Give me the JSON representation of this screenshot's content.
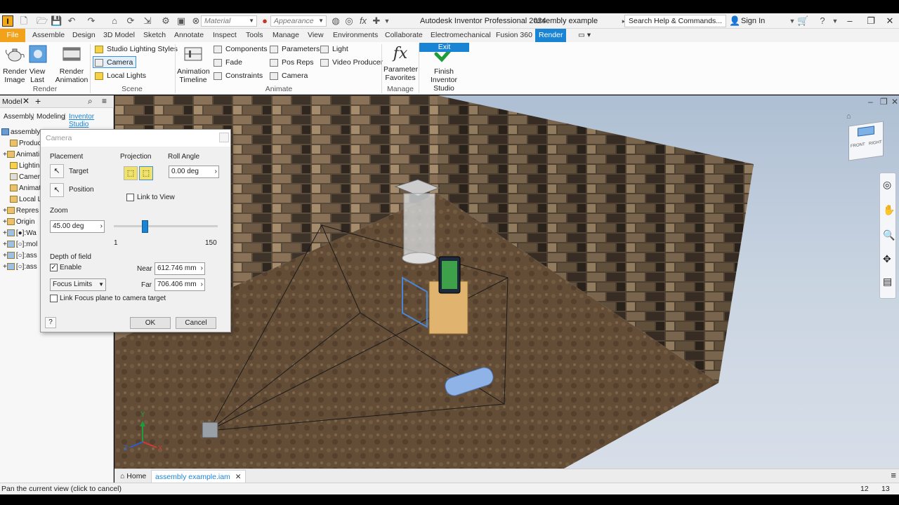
{
  "window": {
    "app_title": "Autodesk Inventor Professional 2024",
    "doc_title": "assembly example",
    "search_placeholder": "Search Help & Commands...",
    "sign_in": "Sign In",
    "material_combo": "Material",
    "appearance_combo": "Appearance"
  },
  "menu_tabs": [
    "File",
    "Assemble",
    "Design",
    "3D Model",
    "Sketch",
    "Annotate",
    "Inspect",
    "Tools",
    "Manage",
    "View",
    "Environments",
    "Collaborate",
    "Electromechanical",
    "Fusion 360",
    "Render"
  ],
  "ribbon": {
    "render_image": [
      "Render",
      "Image"
    ],
    "view_last": [
      "View",
      "Last"
    ],
    "render_animation": [
      "Render",
      "Animation"
    ],
    "render_group": "Render",
    "studio_lighting": "Studio Lighting Styles",
    "camera": "Camera",
    "local_lights": "Local Lights",
    "scene_group": "Scene",
    "animation_timeline": [
      "Animation",
      "Timeline"
    ],
    "components": "Components",
    "fade": "Fade",
    "constraints": "Constraints",
    "parameters": "Parameters",
    "pos_reps": "Pos Reps",
    "camera_anim": "Camera",
    "light": "Light",
    "video_producer": "Video Producer",
    "animate_group": "Animate",
    "parameter_favorites": [
      "Parameter",
      "Favorites"
    ],
    "manage_group": "Manage",
    "finish_studio": [
      "Finish",
      "Inventor Studio"
    ],
    "exit_group": "Exit"
  },
  "model_panel": {
    "title": "Model",
    "tabs": [
      "Assembly",
      "Modeling",
      "Inventor Studio"
    ],
    "tree": [
      "assembly e",
      "Produc",
      "Animati",
      "Lightin",
      "Camera",
      "Animati",
      "Local Li",
      "Repres",
      "Origin",
      "[●]:Wa",
      "[○]:mol",
      "[○]:ass",
      "[○]:ass"
    ]
  },
  "dialog": {
    "title": "Camera",
    "placement": "Placement",
    "target": "Target",
    "position": "Position",
    "projection": "Projection",
    "roll_angle": "Roll Angle",
    "roll_value": "0.00 deg",
    "link_to_view": "Link to View",
    "zoom": "Zoom",
    "zoom_value": "45.00 deg",
    "zoom_min": "1",
    "zoom_max": "150",
    "zoom_fraction": 0.3,
    "depth_of_field": "Depth of field",
    "enable": "Enable",
    "near": "Near",
    "near_value": "612.746 mm",
    "far": "Far",
    "far_value": "706.406 mm",
    "focus_mode": "Focus Limits",
    "link_focus": "Link Focus plane to camera target",
    "ok": "OK",
    "cancel": "Cancel"
  },
  "doc_tabs": {
    "home": "Home",
    "active": "assembly example.iam"
  },
  "viewcube": {
    "front": "FRONT",
    "right": "RIGHT"
  },
  "axes": {
    "x": "X",
    "y": "Y",
    "z": "Z"
  },
  "status": {
    "message": "Pan the current view (click to cancel)",
    "num1": "12",
    "num2": "13"
  },
  "colors": {
    "accent": "#1a84d4",
    "file_tab": "#f2a21a",
    "finish_check": "#1e9e3a"
  }
}
